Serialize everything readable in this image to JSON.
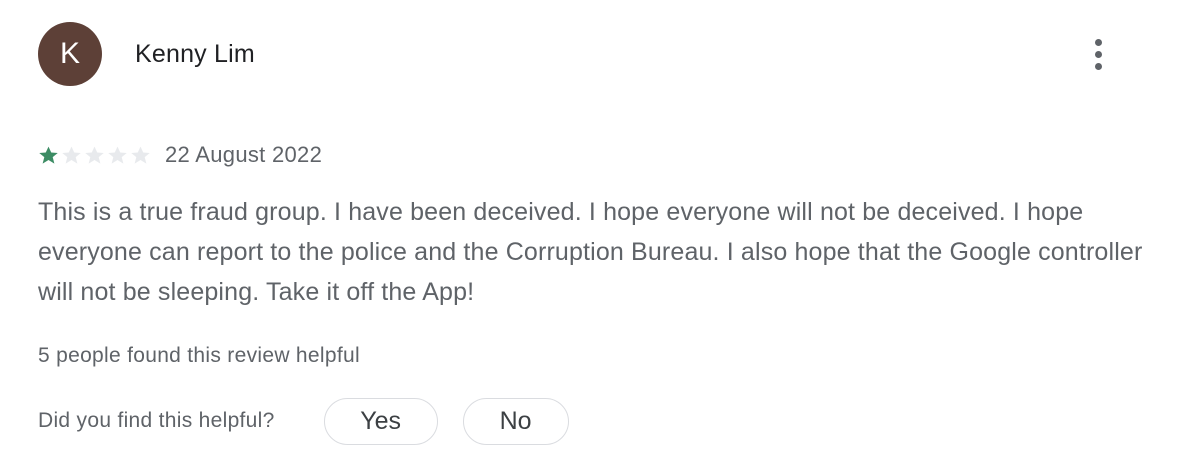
{
  "reviewer": {
    "initial": "K",
    "name": "Kenny Lim",
    "avatar_color": "#5d4037"
  },
  "menu": {
    "icon": "more-vert-icon"
  },
  "rating": {
    "stars": 1,
    "max_stars": 5,
    "filled_color": "#3c8c64",
    "empty_color": "#e8eaed"
  },
  "review": {
    "date": "22 August 2022",
    "text": "This is a true fraud group. I have been deceived. I hope everyone will not be deceived. I hope everyone can report to the police and the Corruption Bureau. I also hope that the Google controller will not be sleeping. Take it off the App!"
  },
  "helpful": {
    "count_text": "5 people found this review helpful",
    "question": "Did you find this helpful?",
    "yes_label": "Yes",
    "no_label": "No"
  }
}
